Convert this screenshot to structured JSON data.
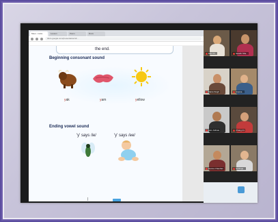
{
  "browser": {
    "tabs": [
      "Meet - Inicio",
      "Lesson",
      "Zoom",
      "Docs"
    ],
    "address": "docs.google.com/presentation/d/...",
    "toolbar_icons": [
      "back-icon",
      "forward-icon",
      "reload-icon"
    ]
  },
  "document": {
    "top_text": "the end.",
    "section1_heading": "Beginning consonant sound",
    "words": [
      {
        "first": "y",
        "rest": "ak"
      },
      {
        "first": "y",
        "rest": "am"
      },
      {
        "first": "y",
        "rest": "ellow"
      }
    ],
    "section2_heading": "Ending vowel sound",
    "says1": "'y' says /ie/",
    "says2": "'y' says /ee/"
  },
  "participants": [
    {
      "name": "Ella Ch...",
      "bg": "#6b5a48"
    },
    {
      "name": "Swathi Sha...",
      "bg": "#4a3a2e"
    },
    {
      "name": "Maria Singh",
      "bg": "#d8d2c8"
    },
    {
      "name": "Anjana...",
      "bg": "#a58a6a"
    },
    {
      "name": "Ivan Jothaw",
      "bg": "#c9c9c9"
    },
    {
      "name": "Chang 21",
      "bg": "#5a4a3d"
    },
    {
      "name": "Hanna Chauhan",
      "bg": "#b3a795"
    },
    {
      "name": "Surthaje...",
      "bg": "#8a7a66"
    }
  ],
  "colors": {
    "frame_border": "#6f60ad",
    "accent_blue": "#4aa3df",
    "mic_muted": "#e53935"
  }
}
